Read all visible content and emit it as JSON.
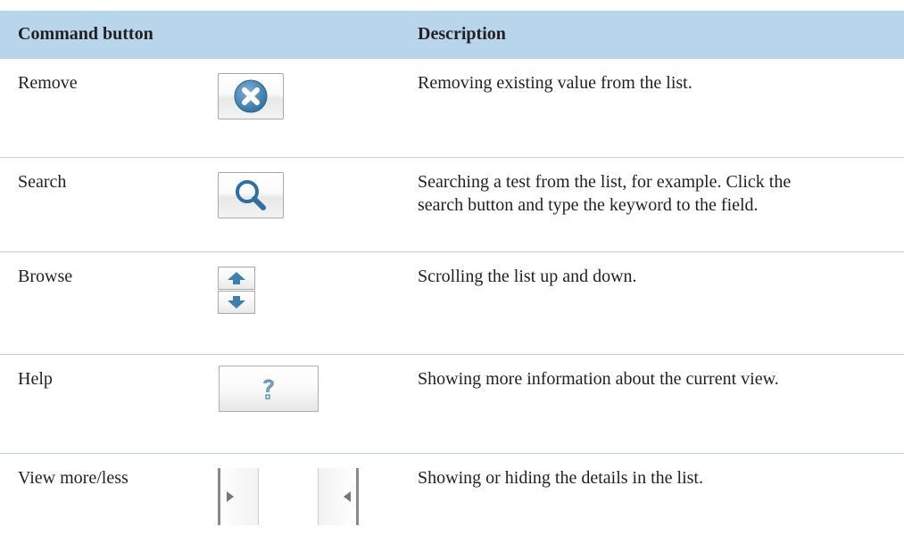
{
  "header": {
    "command_label": "Command button",
    "description_label": "Description"
  },
  "rows": [
    {
      "name": "Remove",
      "icon": "remove-icon",
      "description": [
        "Removing existing value from the list."
      ]
    },
    {
      "name": "Search",
      "icon": "search-icon",
      "description": [
        "Searching a test from the list, for example. Click the",
        "search button and type the keyword to the field."
      ]
    },
    {
      "name": "Browse",
      "icon": "up-down-arrow-icons",
      "description": [
        "Scrolling the list up and down."
      ]
    },
    {
      "name": "Help",
      "icon": "help-icon",
      "description": [
        "Showing more information about the current view."
      ]
    },
    {
      "name": "View more/less",
      "icon": "expand-collapse-handle-icons",
      "description": [
        "Showing or hiding the details in the list."
      ]
    }
  ],
  "colors": {
    "header_bg": "#b8d5ec",
    "icon_blue": "#3f7fb0",
    "text": "#231f20"
  }
}
